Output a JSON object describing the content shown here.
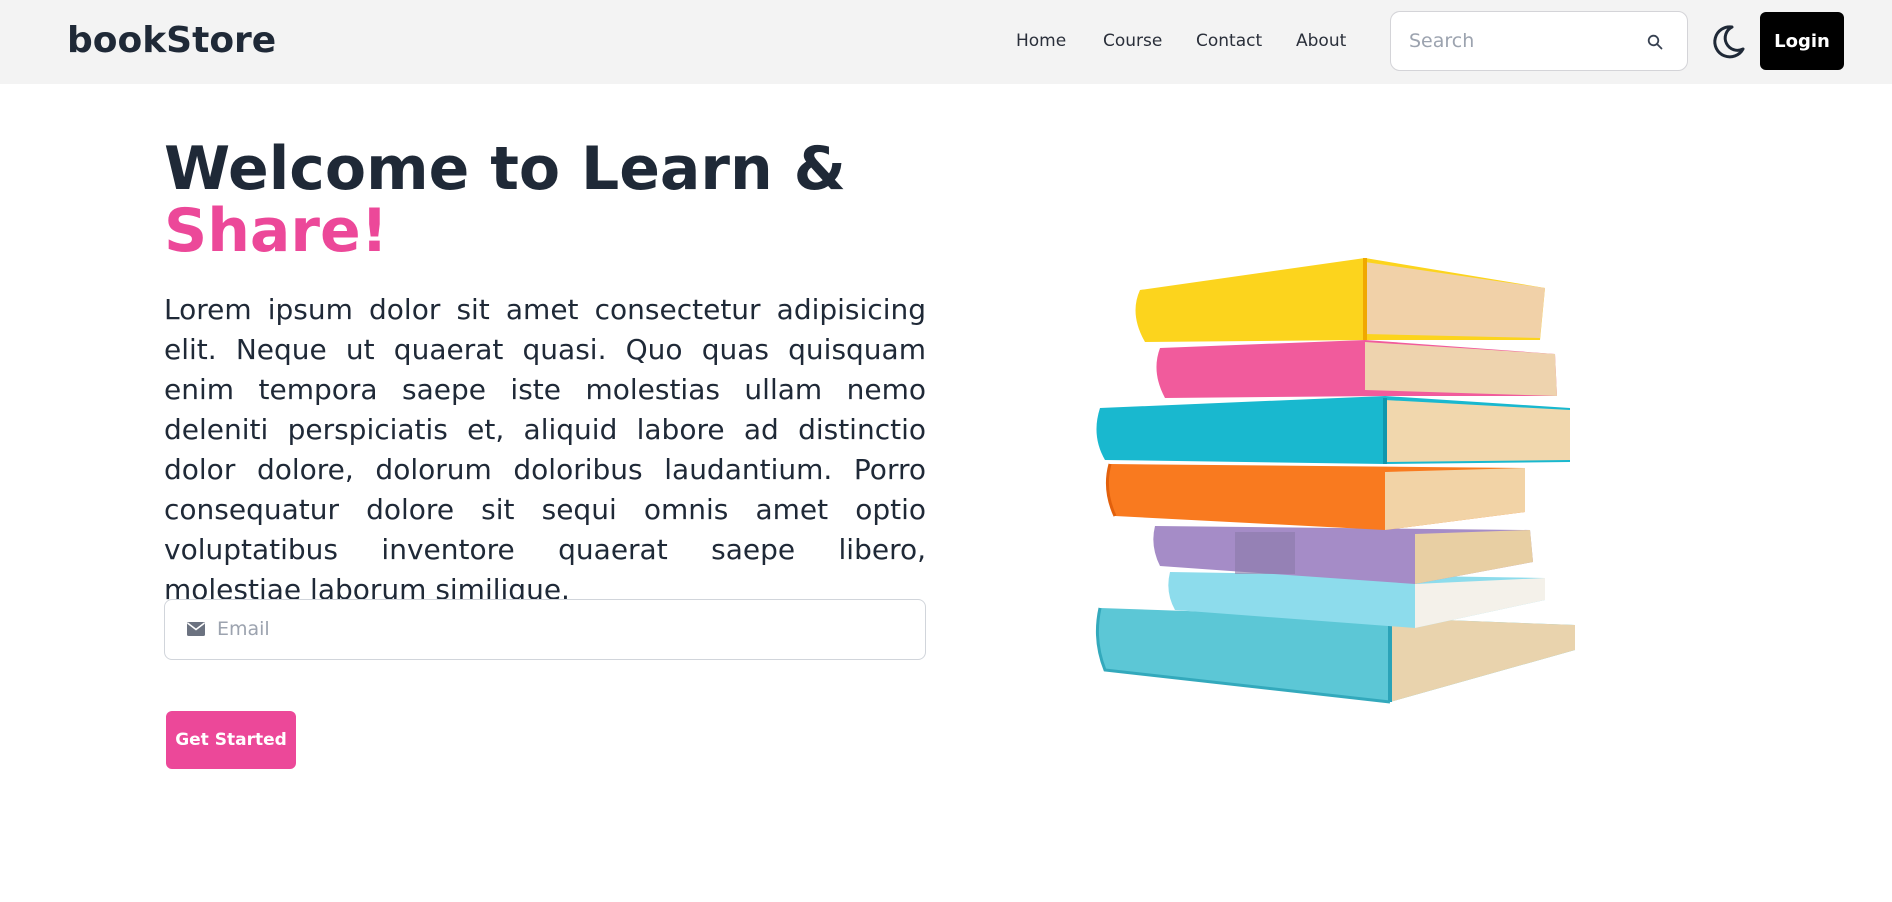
{
  "navbar": {
    "brand": "bookStore",
    "links": [
      {
        "label": "Home"
      },
      {
        "label": "Course"
      },
      {
        "label": "Contact"
      },
      {
        "label": "About"
      }
    ],
    "search": {
      "placeholder": "Search",
      "value": ""
    },
    "theme_icon": "moon-icon",
    "login_label": "Login"
  },
  "hero": {
    "title_line1": "Welcome to Learn &",
    "title_accent": "Share!",
    "description": "Lorem ipsum dolor sit amet consectetur adipisicing elit. Neque ut quaerat quasi. Quo quas quisquam enim tempora saepe iste molestias ullam nemo deleniti perspiciatis et, aliquid labore ad distinctio dolor dolore, dolorum doloribus laudantium. Porro consequatur dolore sit sequi omnis amet optio voluptatibus inventore quaerat saepe libero, molestiae laborum similique.",
    "email": {
      "placeholder": "Email",
      "value": "",
      "icon": "mail-icon"
    },
    "cta_label": "Get Started",
    "illustration": "stack-of-books"
  },
  "colors": {
    "accent": "#ec4899",
    "navbar_bg": "#f3f3f3",
    "text": "#1f2937",
    "login_bg": "#000000"
  }
}
